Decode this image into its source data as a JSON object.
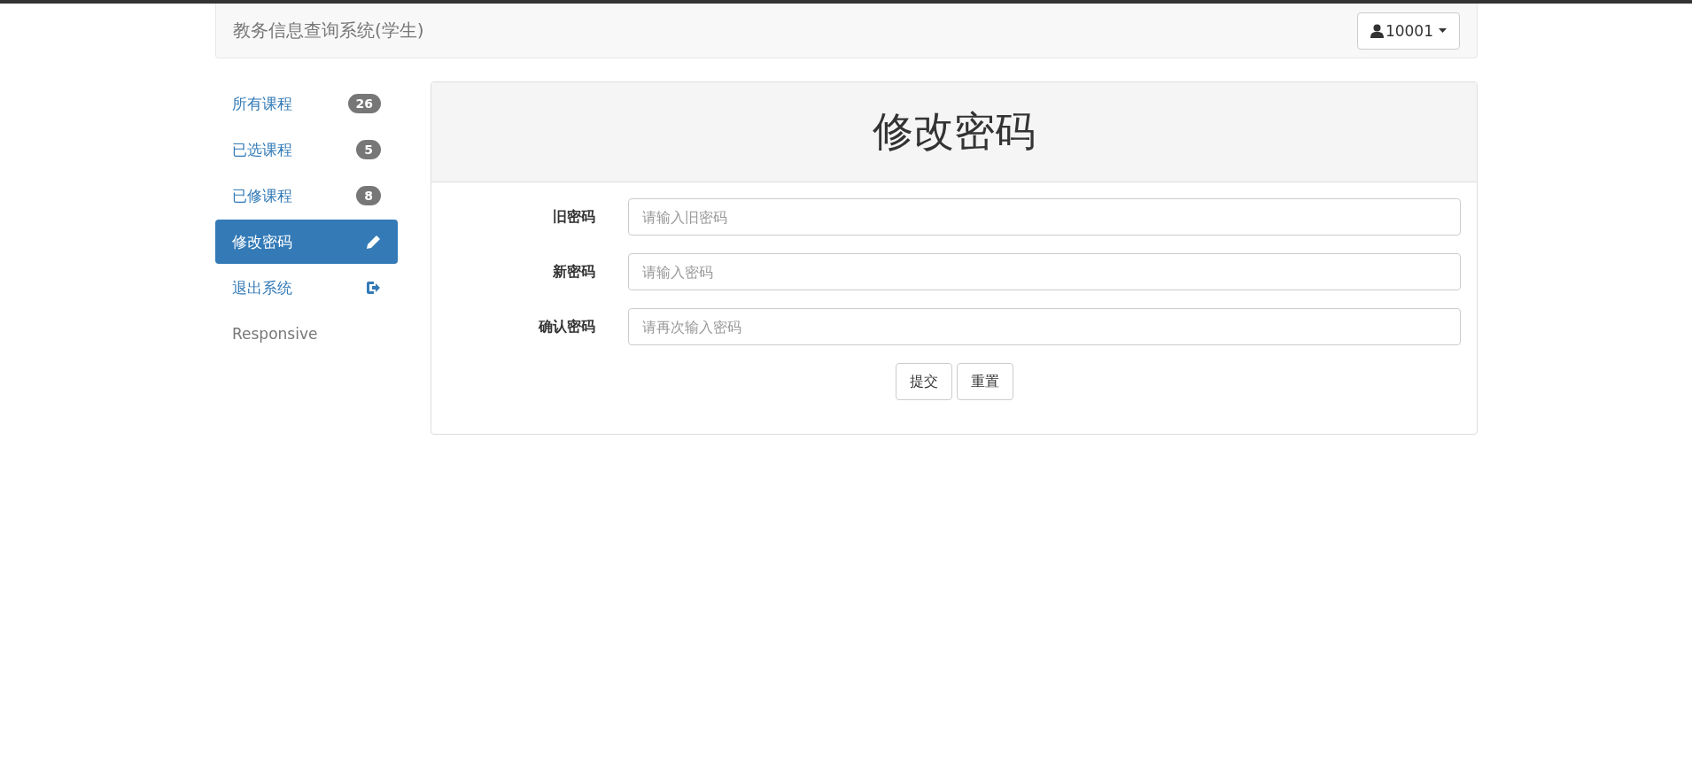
{
  "navbar": {
    "title": "教务信息查询系统(学生)",
    "user_button": "10001"
  },
  "sidebar": {
    "items": [
      {
        "label": "所有课程",
        "kind": "badge",
        "badge": "26",
        "selected": false
      },
      {
        "label": "已选课程",
        "kind": "badge",
        "badge": "5",
        "selected": false
      },
      {
        "label": "已修课程",
        "kind": "badge",
        "badge": "8",
        "selected": false
      },
      {
        "label": "修改密码",
        "kind": "pencil",
        "selected": true
      },
      {
        "label": "退出系统",
        "kind": "exit",
        "selected": false
      },
      {
        "label": "Responsive",
        "kind": "plain",
        "selected": false
      }
    ]
  },
  "panel": {
    "title": "修改密码",
    "fields": [
      {
        "label": "旧密码",
        "placeholder": "请输入旧密码"
      },
      {
        "label": "新密码",
        "placeholder": "请输入密码"
      },
      {
        "label": "确认密码",
        "placeholder": "请再次输入密码"
      }
    ],
    "buttons": [
      "提交",
      "重置"
    ]
  }
}
